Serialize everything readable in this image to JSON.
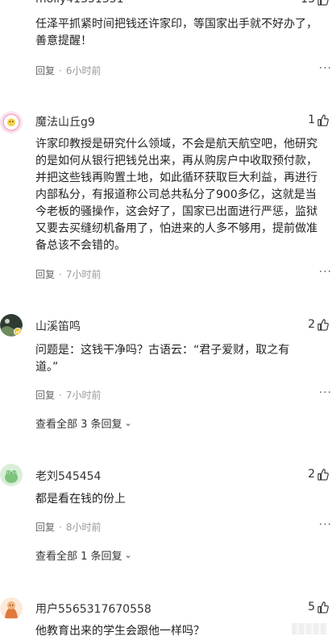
{
  "comments": [
    {
      "username": "molly41351351",
      "likes": "13",
      "lines": [
        "任泽平抓紧时间把钱还许家印，等国家出手就不好办了，",
        "善意提醒！"
      ],
      "reply": "回复",
      "time": "6小时前"
    },
    {
      "username": "魔法山丘g9",
      "likes": "1",
      "lines": [
        "许家印教授是研究什么领域，不会是航天航空吧，他研究",
        "的是如何从银行把钱兑出来，再从购房户中收取预付款，",
        "并把这些钱再购置土地，如此循环获取巨大利益，再进行",
        "内部私分，有报道称公司总共私分了900多亿，这就是当",
        "今老板的骚操作，这会好了，国家已出面进行严惩，监狱",
        "又要去买缝纫机备用了，怕进来的人多不够用，提前做准",
        "备总该不会错的。"
      ],
      "reply": "回复",
      "time": "7小时前"
    },
    {
      "username": "山溪笛鸣",
      "likes": "2",
      "lines": [
        "问题是：这钱干净吗？古语云：“君子爱财，取之有",
        "道。”"
      ],
      "reply": "回复",
      "time": "7小时前",
      "view_replies": "查看全部 3 条回复"
    },
    {
      "username": "老刘545454",
      "likes": "2",
      "lines": [
        "都是看在钱的份上"
      ],
      "reply": "回复",
      "time": "8小时前",
      "view_replies": "查看全部 1 条回复"
    },
    {
      "username": "用户5565317670558",
      "likes": "5",
      "lines": [
        "他教育出来的学生会跟他一样吗？"
      ]
    }
  ],
  "separator_dot": "·",
  "more_glyph": "···",
  "chevron_glyph": "⌄",
  "colors": {
    "text": "#222222",
    "meta": "#999999",
    "background": "#ffffff"
  },
  "icons": {
    "like": "thumbs-up-icon",
    "more": "more-dots-icon",
    "expand": "chevron-down-icon"
  }
}
